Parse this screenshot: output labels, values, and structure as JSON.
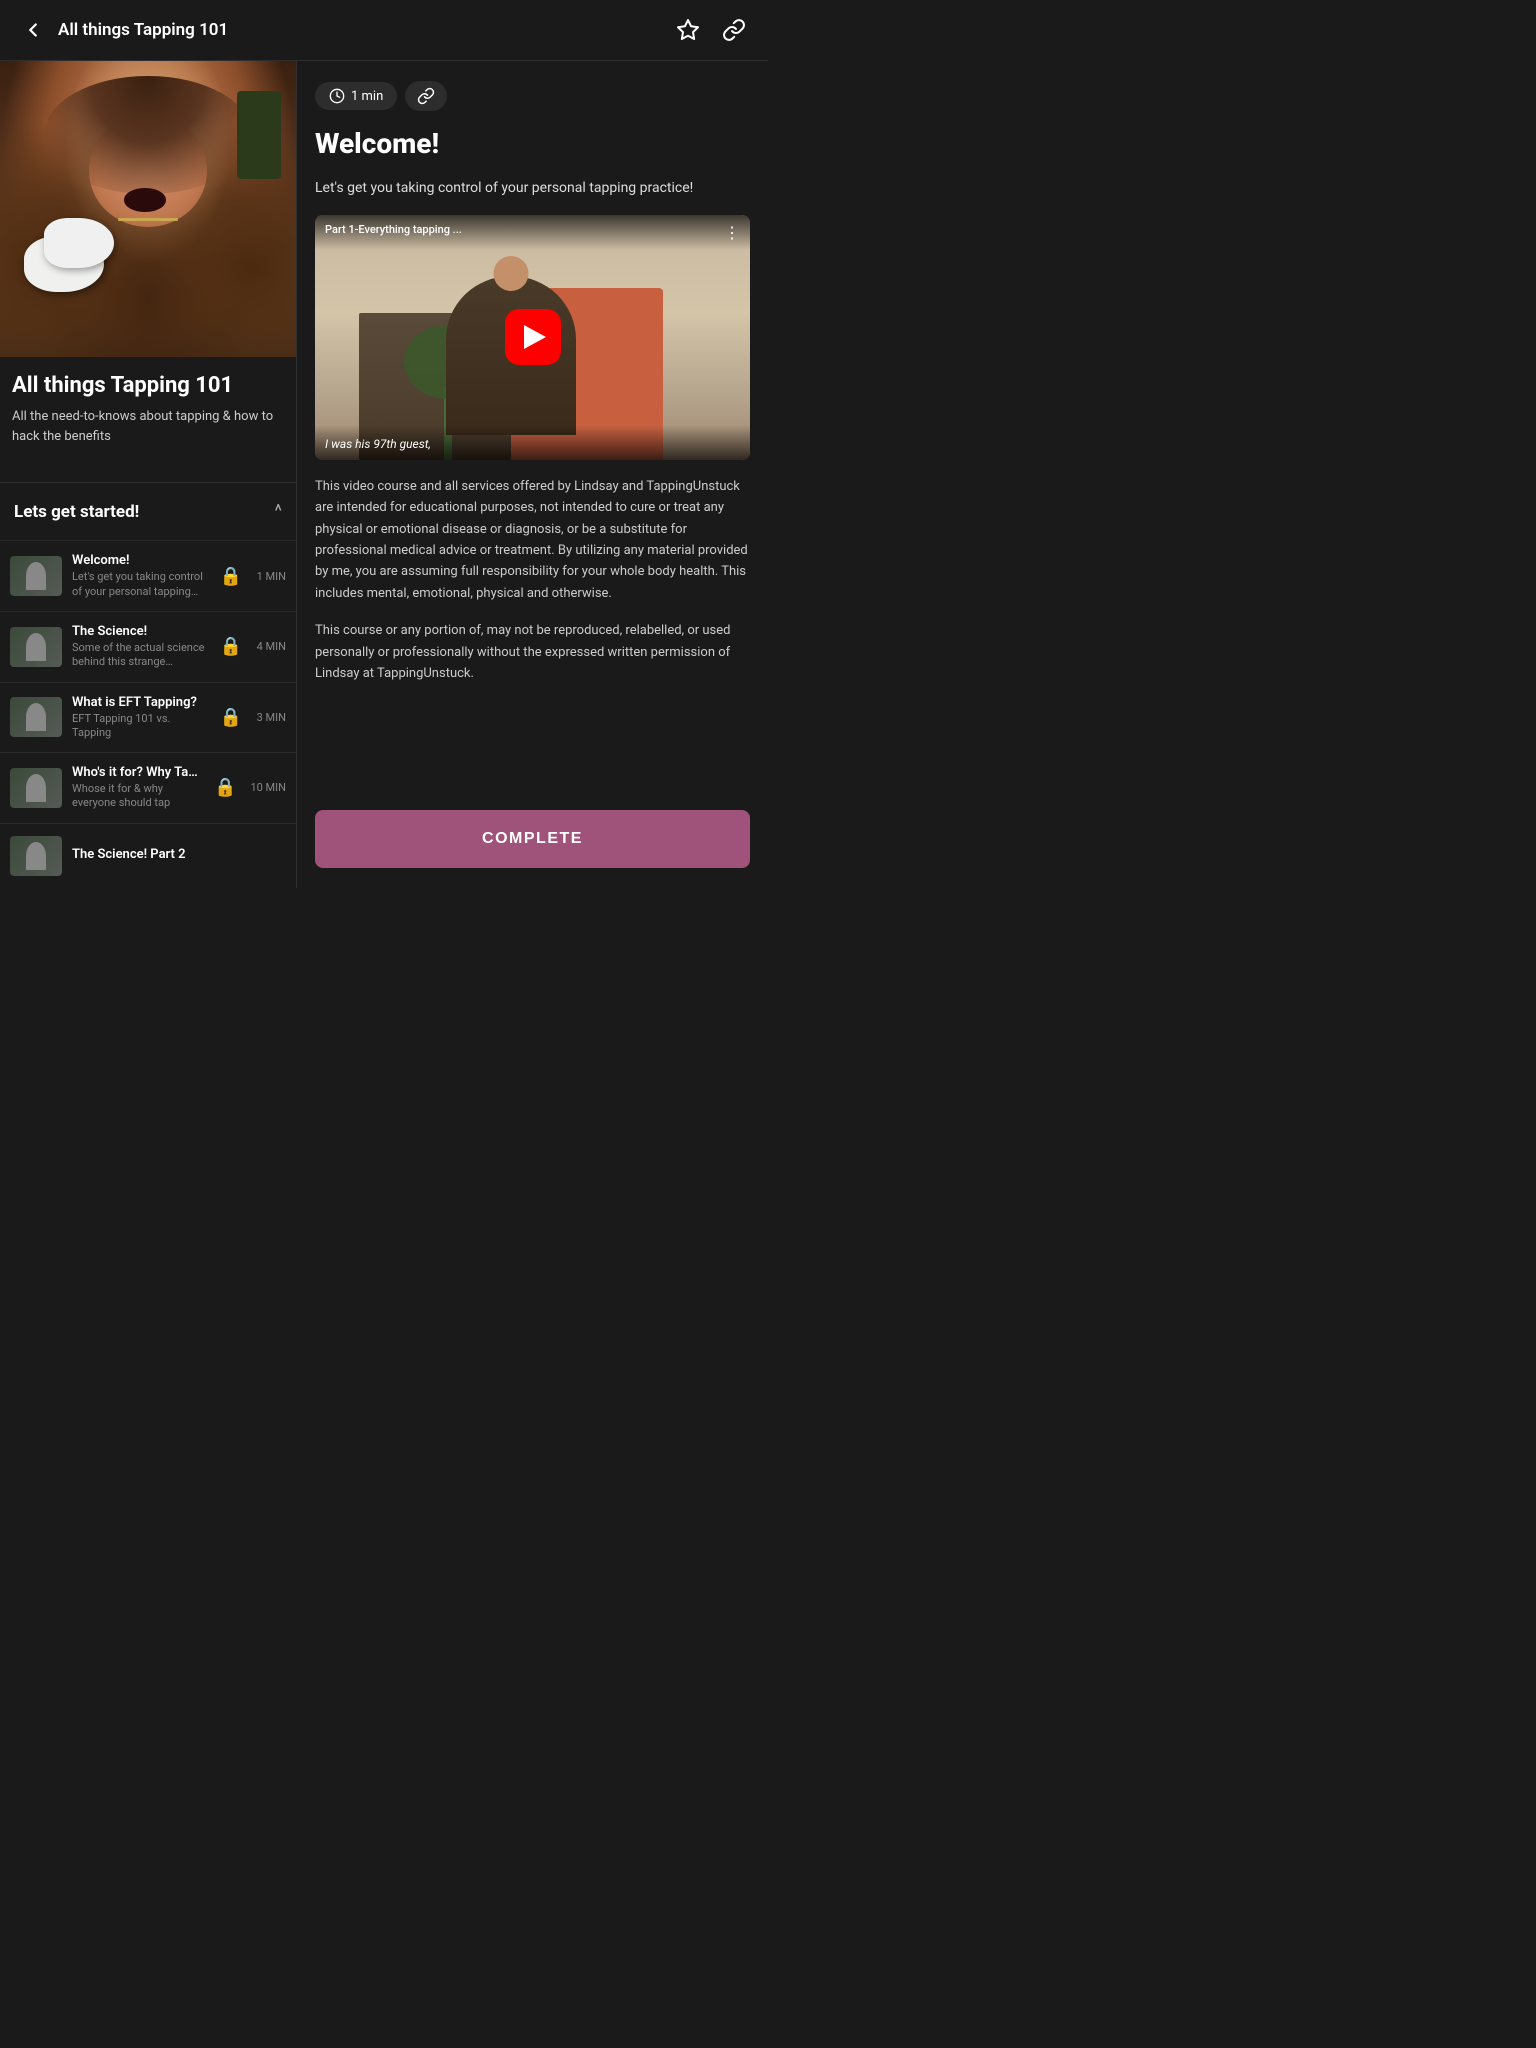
{
  "header": {
    "back_label": "←",
    "title": "All things Tapping 101",
    "bookmark_icon": "bookmark",
    "share_icon": "share"
  },
  "left_panel": {
    "course_title": "All things Tapping 101",
    "course_subtitle": "All the need-to-knows about tapping  & how to hack the benefits",
    "section": {
      "label": "Lets get started!",
      "expanded": true
    },
    "lessons": [
      {
        "title": "Welcome!",
        "desc": "Let's get you taking control of your personal tapping practice!",
        "locked": true,
        "duration": "1 MIN"
      },
      {
        "title": "The Science!",
        "desc": "Some of the actual science behind this strange tapping...",
        "locked": true,
        "duration": "4 MIN"
      },
      {
        "title": "What is EFT Tapping?",
        "desc": "EFT Tapping 101 vs. Tapping",
        "locked": true,
        "duration": "3 MIN"
      },
      {
        "title": "Who's it for? Why Tap?",
        "desc": "Whose it for & why everyone should tap",
        "locked": true,
        "duration": "10 MIN"
      },
      {
        "title": "The Science! Part 2",
        "desc": "",
        "locked": false,
        "duration": ""
      }
    ]
  },
  "right_panel": {
    "duration": "1 min",
    "lesson_title": "Welcome!",
    "lesson_intro": "Let's get you taking control of your personal tapping practice!",
    "video": {
      "title": "Part 1-Everything tapping ...",
      "caption": "I was his 97th guest,"
    },
    "disclaimer1": "This video course and all services offered by Lindsay and TappingUnstuck are intended for educational purposes, not intended to cure or treat any physical or emotional disease or diagnosis, or be a substitute for professional medical advice or treatment. By utilizing any material provided by me, you are assuming full responsibility for your whole body health. This includes mental, emotional, physical and otherwise.",
    "disclaimer2": "This course or any portion of, may not be reproduced, relabelled, or used personally or professionally without the expressed written permission of Lindsay at TappingUnstuck.",
    "complete_button": "COMPLETE"
  },
  "colors": {
    "background": "#1a1a1a",
    "accent": "#a0537a",
    "text_primary": "#ffffff",
    "text_secondary": "#cccccc",
    "text_muted": "#888888",
    "border": "#2e2e2e",
    "surface": "#2d2d2d"
  }
}
